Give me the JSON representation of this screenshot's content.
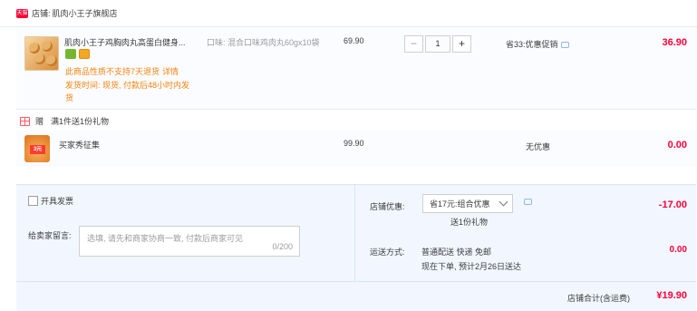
{
  "shop": {
    "badge": "天猫",
    "label": "店铺:",
    "name": "肌肉小王子旗舰店"
  },
  "item": {
    "title": "肌肉小王子鸡胸肉丸高蛋白健身...",
    "sku": "口味: 混合口味鸡肉丸60gx10袋",
    "service_icons": [
      "green-service-icon",
      "card-service-icon"
    ],
    "no_return": "此商品性质不支持7天退货",
    "details_link": "详情",
    "ship_time": "发货时间: 现货, 付款后48小时内发货",
    "unit_price": "69.90",
    "quantity": "1",
    "minus": "−",
    "plus": "+",
    "discount": "省33:优惠促销",
    "total": "36.90"
  },
  "gift": {
    "tag": "赠",
    "description": "满1件送1份礼物",
    "name": "买家秀征集",
    "thumb_badge": "3元",
    "price": "99.90",
    "promo": "无优惠",
    "total": "0.00"
  },
  "options": {
    "invoice_label": "开具发票",
    "memo_label": "给卖家留言:",
    "memo_placeholder": "选填, 请先和商家协商一致, 付款后商家可见",
    "memo_count": "0/200",
    "shop_promo_label": "店铺优惠:",
    "shop_promo_value": "省17元:组合优惠",
    "shop_promo_gift": "送1份礼物",
    "shop_promo_amount": "-17.00",
    "ship_label": "运送方式:",
    "ship_method": "普通配送 快递 免邮",
    "ship_eta": "现在下单, 预计2月26日送达",
    "ship_cost": "0.00"
  },
  "summary": {
    "label": "店铺合计(含运费)",
    "amount": "¥19.90"
  },
  "colors": {
    "price_red": "#ff0036",
    "warning_orange": "#f5830d",
    "option_bg": "#f2f7ff"
  }
}
